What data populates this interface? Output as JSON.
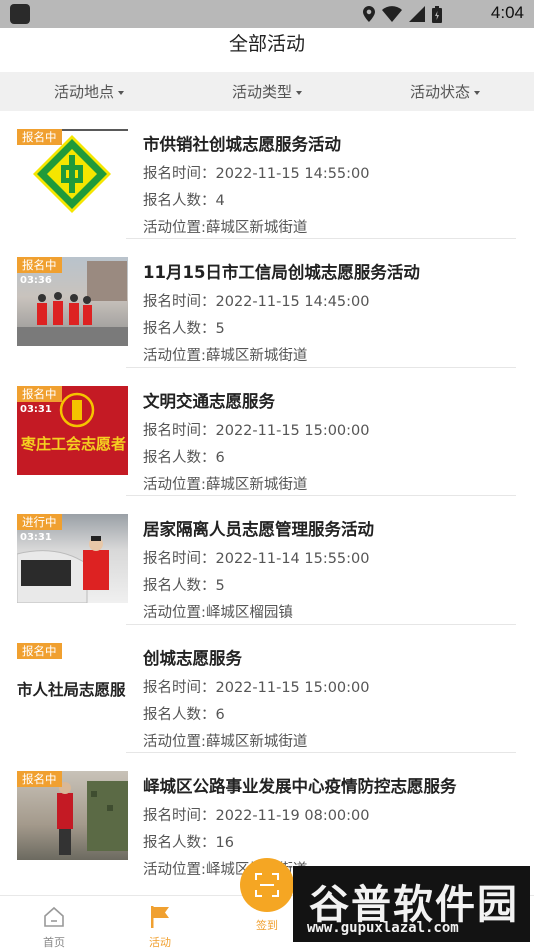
{
  "status_bar": {
    "time": "4:04"
  },
  "header": {
    "title": "全部活动"
  },
  "filters": [
    {
      "label": "活动地点"
    },
    {
      "label": "活动类型"
    },
    {
      "label": "活动状态"
    }
  ],
  "activities": [
    {
      "badge": "报名中",
      "title": "市供销社创城志愿服务活动",
      "time": "报名时间：2022-11-15 14:55:00",
      "count": "报名人数：4",
      "location": "活动位置:薛城区新城街道"
    },
    {
      "badge": "报名中",
      "title": "11月15日市工信局创城志愿服务活动",
      "time": "报名时间：2022-11-15 14:45:00",
      "count": "报名人数：5",
      "location": "活动位置:薛城区新城街道",
      "thumb_overlay": "03:36"
    },
    {
      "badge": "报名中",
      "title": "文明交通志愿服务",
      "time": "报名时间：2022-11-15 15:00:00",
      "count": "报名人数：6",
      "location": "活动位置:薛城区新城街道",
      "thumb_overlay": "03:31",
      "banner_text": "枣庄工会志愿者"
    },
    {
      "badge": "进行中",
      "title": "居家隔离人员志愿管理服务活动",
      "time": "报名时间：2022-11-14 15:55:00",
      "count": "报名人数：5",
      "location": "活动位置:峄城区榴园镇",
      "thumb_overlay": "03:31"
    },
    {
      "badge": "报名中",
      "title": "创城志愿服务",
      "time": "报名时间：2022-11-15 15:00:00",
      "count": "报名人数：6",
      "location": "活动位置:薛城区新城街道",
      "thumb_text": "市人社局志愿服"
    },
    {
      "badge": "报名中",
      "title": "峄城区公路事业发展中心疫情防控志愿服务",
      "time": "报名时间：2022-11-19 08:00:00",
      "count": "报名人数：16",
      "location": "活动位置:峄城区坛山街道"
    }
  ],
  "tabbar": {
    "home": "首页",
    "activity": "活动",
    "checkin": "签到"
  },
  "watermark": {
    "text": "谷普软件园",
    "url": "www.gupuxlazal.com"
  },
  "colors": {
    "accent": "#f0a030",
    "filter_bg": "#f0f0f0",
    "status_bar": "#b8b8b8"
  }
}
